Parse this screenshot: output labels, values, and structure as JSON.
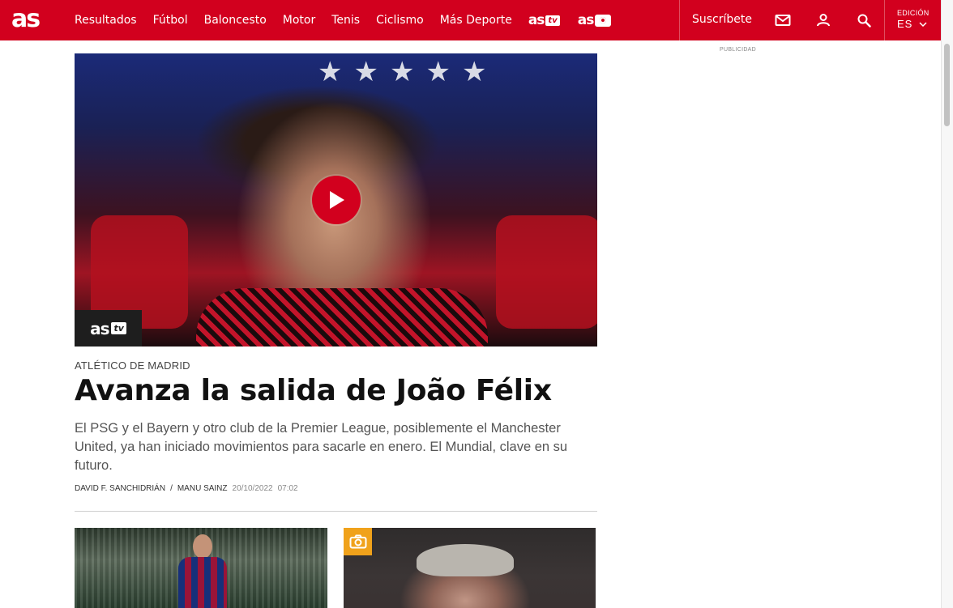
{
  "header": {
    "logo_text": "as",
    "nav": [
      "Resultados",
      "Fútbol",
      "Baloncesto",
      "Motor",
      "Tenis",
      "Ciclismo",
      "Más Deporte"
    ],
    "brand_tv": {
      "as": "as",
      "tv": "tv"
    },
    "brand_photo": {
      "as": "as"
    },
    "subscribe_label": "Suscríbete",
    "icons": [
      "mail-icon",
      "user-icon",
      "search-icon"
    ],
    "edition_label": "EDICIÓN",
    "edition_value": "ES",
    "brand_color": "#d2001e"
  },
  "sidebar": {
    "ad_label": "PUBLICIDAD"
  },
  "main_article": {
    "video_badge": {
      "as": "as",
      "tv": "tv"
    },
    "kicker": "ATLÉTICO DE MADRID",
    "headline": "Avanza la salida de João Félix",
    "summary": "El PSG y el Bayern y otro club de la Premier League, posiblemente el Manchester United, ya han iniciado movimientos para sacarle en enero. El Mundial, clave en su futuro.",
    "authors": [
      "DAVID F. SANCHIDRIÁN",
      "MANU SAINZ"
    ],
    "author_separator": "/",
    "date": "20/10/2022",
    "time": "07:02"
  },
  "gallery_badge_color": "#f0a21b"
}
